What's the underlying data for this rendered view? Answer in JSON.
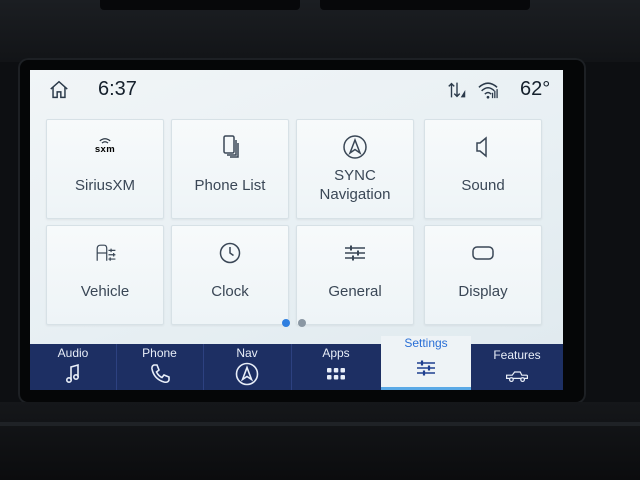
{
  "status_bar": {
    "time": "6:37",
    "temperature": "62°"
  },
  "tiles": [
    {
      "label": "SiriusXM",
      "icon": "siriusxm-logo-icon",
      "logo_text": "sxm"
    },
    {
      "label": "Phone List",
      "icon": "phone-list-icon"
    },
    {
      "label": "SYNC Navigation",
      "line1": "SYNC",
      "line2": "Navigation",
      "icon": "navigation-arrow-icon"
    },
    {
      "label": "Sound",
      "icon": "speaker-icon"
    },
    {
      "label": "Vehicle",
      "icon": "vehicle-settings-icon"
    },
    {
      "label": "Clock",
      "icon": "clock-icon"
    },
    {
      "label": "General",
      "icon": "sliders-icon"
    },
    {
      "label": "Display",
      "icon": "display-icon"
    }
  ],
  "pagination": {
    "current_page": 1,
    "total_pages": 2
  },
  "nav": [
    {
      "label": "Audio",
      "icon": "music-note-icon"
    },
    {
      "label": "Phone",
      "icon": "phone-icon"
    },
    {
      "label": "Nav",
      "icon": "navigation-arrow-icon"
    },
    {
      "label": "Apps",
      "icon": "apps-grid-icon"
    },
    {
      "label": "Settings",
      "icon": "settings-sliders-icon",
      "active": true
    },
    {
      "label": "Features",
      "icon": "truck-icon"
    }
  ],
  "colors": {
    "nav_background": "#1d2f63",
    "active_tab_label": "#2a6fd6",
    "active_tab_indicator": "#5aa9e6",
    "pagination_active": "#2f7fe0",
    "pagination_inactive": "#8a97a3"
  }
}
